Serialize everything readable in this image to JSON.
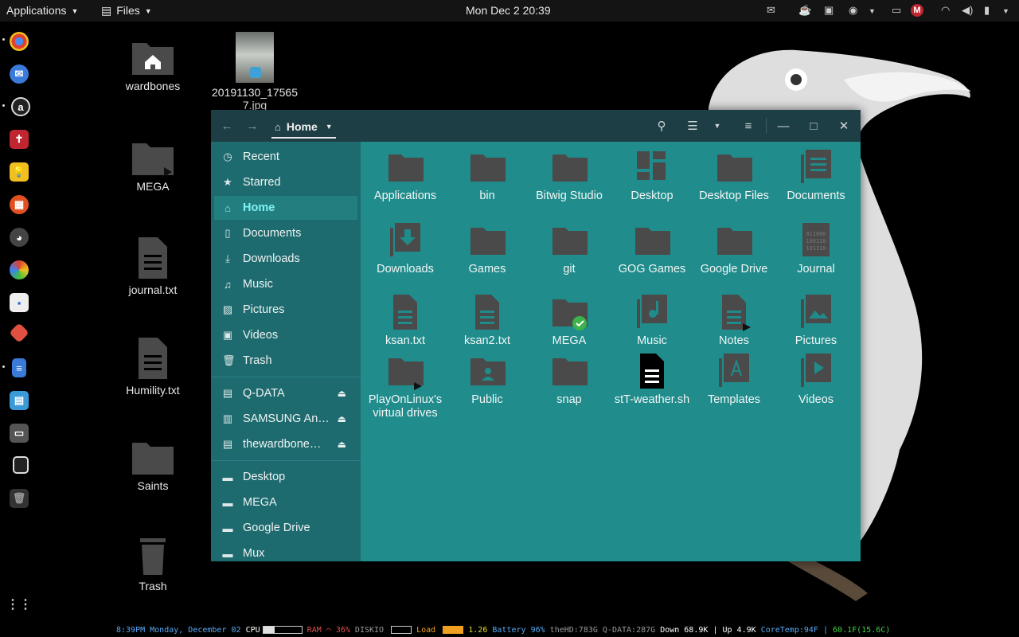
{
  "topbar": {
    "applications_label": "Applications",
    "files_label": "Files",
    "clock": "Mon Dec 2  20:39",
    "tray_mega": "M"
  },
  "desktop_icons": [
    {
      "label": "wardbones",
      "icon": "home-folder-icon"
    },
    {
      "label": "20191130_175657.jpg",
      "icon": "photo-thumbnail"
    },
    {
      "label": "MEGA",
      "icon": "folder-link-icon"
    },
    {
      "label": "journal.txt",
      "icon": "text-file-link-icon"
    },
    {
      "label": "Humility.txt",
      "icon": "text-file-icon"
    },
    {
      "label": "Saints",
      "icon": "folder-icon"
    },
    {
      "label": "Trash",
      "icon": "trash-icon"
    }
  ],
  "window": {
    "path_label": "Home",
    "sidebar": {
      "places": [
        {
          "label": "Recent",
          "icon": "clock-icon"
        },
        {
          "label": "Starred",
          "icon": "star-icon"
        },
        {
          "label": "Home",
          "icon": "home-icon",
          "active": true
        },
        {
          "label": "Documents",
          "icon": "documents-icon"
        },
        {
          "label": "Downloads",
          "icon": "download-icon"
        },
        {
          "label": "Music",
          "icon": "music-icon"
        },
        {
          "label": "Pictures",
          "icon": "pictures-icon"
        },
        {
          "label": "Videos",
          "icon": "videos-icon"
        },
        {
          "label": "Trash",
          "icon": "trash-icon"
        }
      ],
      "devices": [
        {
          "label": "Q-DATA",
          "icon": "drive-icon"
        },
        {
          "label": "SAMSUNG An…",
          "icon": "phone-drive-icon"
        },
        {
          "label": "thewardbone…",
          "icon": "drive-icon"
        }
      ],
      "bookmarks": [
        {
          "label": "Desktop",
          "icon": "folder-icon"
        },
        {
          "label": "MEGA",
          "icon": "folder-icon"
        },
        {
          "label": "Google Drive",
          "icon": "folder-icon"
        },
        {
          "label": "Mux",
          "icon": "folder-icon"
        }
      ]
    },
    "files": [
      {
        "label": "Applications",
        "icon": "folder-icon"
      },
      {
        "label": "bin",
        "icon": "folder-icon"
      },
      {
        "label": "Bitwig Studio",
        "icon": "folder-icon"
      },
      {
        "label": "Desktop",
        "icon": "desktop-folder-icon"
      },
      {
        "label": "Desktop Files",
        "icon": "folder-icon"
      },
      {
        "label": "Documents",
        "icon": "documents-folder-icon"
      },
      {
        "label": "Downloads",
        "icon": "downloads-folder-icon"
      },
      {
        "label": "Games",
        "icon": "folder-icon"
      },
      {
        "label": "git",
        "icon": "folder-icon"
      },
      {
        "label": "GOG Games",
        "icon": "folder-icon"
      },
      {
        "label": "Google Drive",
        "icon": "folder-icon"
      },
      {
        "label": "Journal",
        "icon": "binary-file-icon"
      },
      {
        "label": "ksan.txt",
        "icon": "text-file-icon"
      },
      {
        "label": "ksan2.txt",
        "icon": "text-file-icon"
      },
      {
        "label": "MEGA",
        "icon": "folder-synced-icon"
      },
      {
        "label": "Music",
        "icon": "music-folder-icon"
      },
      {
        "label": "Notes",
        "icon": "text-file-link-icon"
      },
      {
        "label": "Pictures",
        "icon": "pictures-folder-icon"
      },
      {
        "label": "PlayOnLinux's virtual drives",
        "icon": "folder-link-icon"
      },
      {
        "label": "Public",
        "icon": "public-folder-icon"
      },
      {
        "label": "snap",
        "icon": "folder-icon"
      },
      {
        "label": "stT-weather.sh",
        "icon": "script-file-icon"
      },
      {
        "label": "Templates",
        "icon": "templates-folder-icon"
      },
      {
        "label": "Videos",
        "icon": "videos-folder-icon"
      }
    ]
  },
  "conky": {
    "time": "8:39PM Monday, December 02",
    "cpu_label": "CPU",
    "ram_label": "RAM",
    "ram_value": "36%",
    "diskio_label": "DISKIO",
    "load_label": "Load",
    "load_value": "1.26",
    "battery_label": "Battery",
    "battery_value": "96%",
    "thehd": "theHD:783G",
    "qdata": "Q-DATA:287G",
    "down": "Down 68.9K",
    "up": "Up 4.9K",
    "coretemp": "CoreTemp:94F",
    "weather": "60.1F(15.6C)",
    "separator": "|"
  }
}
